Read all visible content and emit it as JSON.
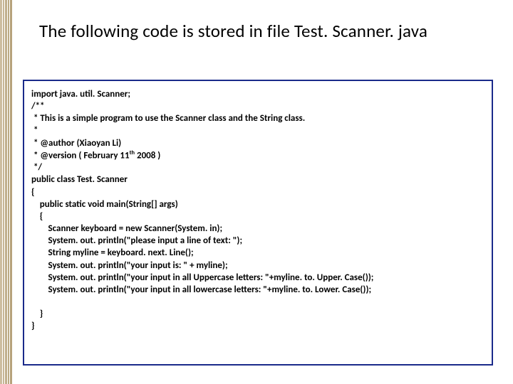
{
  "title": "The following code is stored in file Test. Scanner. java",
  "code": {
    "l01": "import java. util. Scanner;",
    "l02": "/**",
    "l03": " * This is a simple program to use the Scanner class and the String class.",
    "l04": " *",
    "l05": " * @author (Xiaoyan Li)",
    "l06a": " * @version ( February 11",
    "l06b": "th",
    "l06c": " 2008 )",
    "l07": " */",
    "l08": "public class Test. Scanner",
    "l09": "{",
    "l10": "    public static void main(String[] args)",
    "l11": "    {",
    "l12": "        Scanner keyboard = new Scanner(System. in);",
    "l13": "        System. out. println(\"please input a line of text: \");",
    "l14": "        String myline = keyboard. next. Line();",
    "l15": "        System. out. println(\"your input is: \" + myline);",
    "l16": "        System. out. println(\"your input in all Uppercase letters: \"+myline. to. Upper. Case());",
    "l17": "        System. out. println(\"your input in all lowercase letters: \"+myline. to. Lower. Case());",
    "l18": "",
    "l19": "    }",
    "l20": "}"
  }
}
